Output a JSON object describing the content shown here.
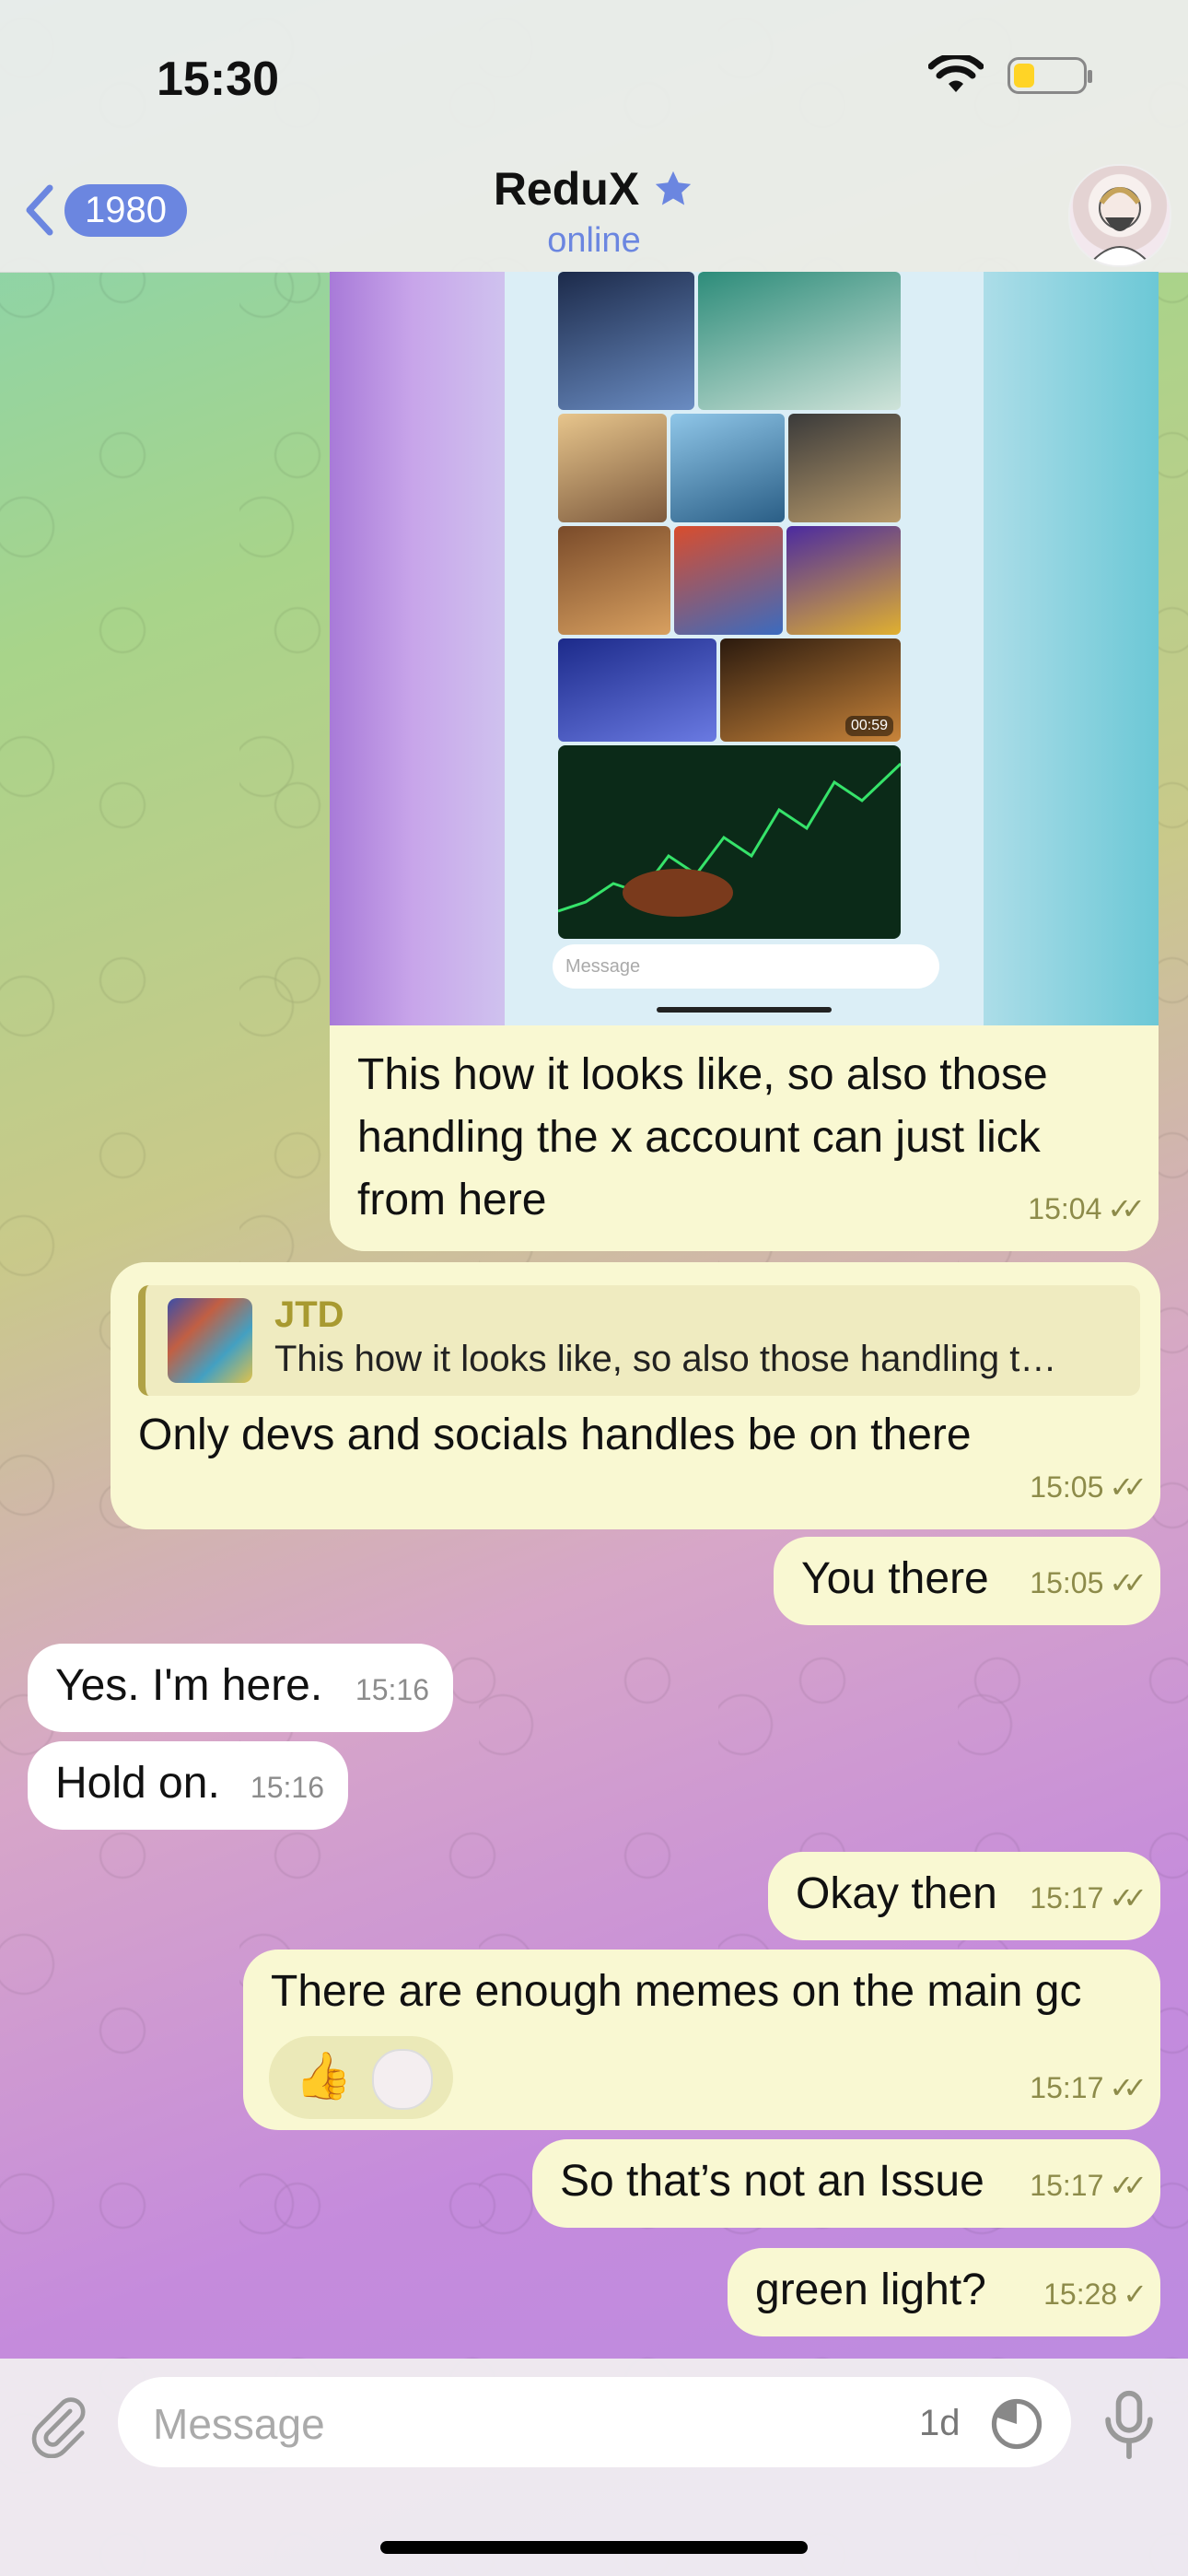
{
  "status_bar": {
    "time": "15:30"
  },
  "header": {
    "back_count": "1980",
    "title": "ReduX",
    "subtitle": "online"
  },
  "messages": [
    {
      "direction": "out",
      "type": "media",
      "text": "This how it looks like, so also those handling the x account can just lick from here",
      "time": "15:04",
      "status": "read",
      "media_caption_items": {
        "timer": "00:59",
        "phone_placeholder": "Message"
      }
    },
    {
      "direction": "out",
      "type": "reply",
      "reply_author": "JTD",
      "reply_snippet": "This how it looks like, so also those handling t…",
      "text": "Only devs and socials handles be on there",
      "time": "15:05",
      "status": "read"
    },
    {
      "direction": "out",
      "text": "You there",
      "time": "15:05",
      "status": "read"
    },
    {
      "direction": "in",
      "text": "Yes. I'm here.",
      "time": "15:16"
    },
    {
      "direction": "in",
      "text": "Hold on.",
      "time": "15:16"
    },
    {
      "direction": "out",
      "text": "Okay then",
      "time": "15:17",
      "status": "read"
    },
    {
      "direction": "out",
      "text": "There are enough memes on the main gc",
      "time": "15:17",
      "status": "read",
      "reaction": "👍"
    },
    {
      "direction": "out",
      "text": "So that’s not an Issue",
      "time": "15:17",
      "status": "read"
    },
    {
      "direction": "out",
      "text": "green light?",
      "time": "15:28",
      "status": "sent"
    }
  ],
  "input": {
    "placeholder": "Message",
    "timer_label": "1d"
  },
  "icons": [
    "wifi-icon",
    "battery-icon",
    "back-chevron-icon",
    "star-icon",
    "paperclip-icon",
    "timer-icon",
    "microphone-icon"
  ],
  "colors": {
    "accent": "#6b86e0",
    "outgoing_bubble": "#f9f8d2",
    "incoming_bubble": "#ffffff",
    "check": "#8d8b4a"
  }
}
